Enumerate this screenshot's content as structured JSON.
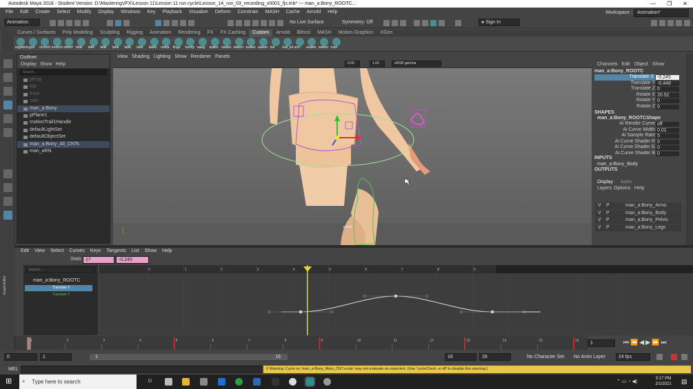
{
  "title": "Autodesk Maya 2018 - Student Version: D:\\MasteringVFX\\Lesson 11\\Lesson 11 run cycle\\Lesson_14_run_03_recording_v0001_fjs.mb* --- man_a:Bony_ROOTC...",
  "menubar": [
    "File",
    "Edit",
    "Create",
    "Select",
    "Modify",
    "Display",
    "Windows",
    "Key",
    "Playback",
    "Visualize",
    "Deform",
    "Constrain",
    "MASH",
    "Cache",
    "Arnold",
    "Help"
  ],
  "workspace": {
    "label": "Workspace :",
    "value": "Animation*"
  },
  "statusline": {
    "mode": "Animation",
    "live_surface": "No Live Surface",
    "symmetry": "Symmetry: Off",
    "signin": "Sign In"
  },
  "shelf_tabs": [
    "Curves / Surfaces",
    "Poly Modeling",
    "Sculpting",
    "Rigging",
    "Animation",
    "Rendering",
    "FX",
    "FX Caching",
    "Custom",
    "Arnold",
    "Bifrost",
    "MASH",
    "Motion Graphics",
    "XGen"
  ],
  "shelf_active": "Custom",
  "shelf_buttons": [
    "mgskint",
    "cgull",
    "mcbich",
    "mcbich",
    "mbitcf",
    "tattk",
    "tattk",
    "tattk",
    "tattk",
    "tattk",
    "tattk",
    "tatAll",
    "mafia",
    "fings",
    "handy",
    "aaog",
    "walke",
    "walker",
    "walker",
    "walker",
    "walker",
    "tail",
    "ball_tal",
    "arm",
    "walker",
    "walker",
    "man"
  ],
  "outliner": {
    "title": "Outliner",
    "menu": [
      "Display",
      "Show",
      "Help"
    ],
    "search": "Search...",
    "items": [
      {
        "label": "persp",
        "dim": true
      },
      {
        "label": "top",
        "dim": true
      },
      {
        "label": "front",
        "dim": true
      },
      {
        "label": "side",
        "dim": true
      },
      {
        "label": "man_a:Bony",
        "sel": true
      },
      {
        "label": "pPlane1"
      },
      {
        "label": "motionTrail1Handle"
      },
      {
        "label": "defaultLightSet"
      },
      {
        "label": "defaultObjectSet"
      },
      {
        "label": "man_a:Bony_All_CNTs",
        "sel": true
      },
      {
        "label": "man_aRN"
      }
    ]
  },
  "viewport": {
    "menu": [
      "View",
      "Shading",
      "Lighting",
      "Show",
      "Renderer",
      "Panels"
    ],
    "val1": "0.00",
    "val2": "1.00",
    "colorspace": "sRGB gamma",
    "camera": "persp"
  },
  "channelbox": {
    "menu": [
      "Channels",
      "Edit",
      "Object",
      "Show"
    ],
    "node": "man_a:Bony_ROOTC",
    "channels": [
      {
        "name": "Translate X",
        "value": "-0.245",
        "hi": true
      },
      {
        "name": "Translate Y",
        "value": "-0.448"
      },
      {
        "name": "Translate Z",
        "value": "0"
      },
      {
        "name": "Rotate X",
        "value": "20.52"
      },
      {
        "name": "Rotate Y",
        "value": "0"
      },
      {
        "name": "Rotate Z",
        "value": "0"
      }
    ],
    "shapes_label": "SHAPES",
    "shape_node": "man_a:Bony_ROOTCShape",
    "shape_attrs": [
      {
        "name": "Ai Render Curve",
        "value": "off"
      },
      {
        "name": "Ai Curve Width",
        "value": "0.01"
      },
      {
        "name": "Ai Sample Rate",
        "value": "5"
      },
      {
        "name": "Ai Curve Shader R",
        "value": "0"
      },
      {
        "name": "Ai Curve Shader G",
        "value": "0"
      },
      {
        "name": "Ai Curve Shader B",
        "value": "0"
      }
    ],
    "inputs_label": "INPUTS",
    "input_node": "man_a:Bony_Body",
    "outputs_label": "OUTPUTS"
  },
  "layers": {
    "tabs": [
      "Display",
      "Anim"
    ],
    "menu": [
      "Layers",
      "Options",
      "Help"
    ],
    "rows": [
      "man_a:Bony_Arms",
      "man_a:Bony_Body",
      "man_a:Bony_Pelvis",
      "man_a:Bony_Legs"
    ]
  },
  "graph_editor": {
    "side_label": "Graph Editor",
    "menu": [
      "Edit",
      "View",
      "Select",
      "Curves",
      "Keys",
      "Tangents",
      "List",
      "Show",
      "Help"
    ],
    "stats_label": "Stats",
    "stat1": "17",
    "stat2": "-0.245",
    "search": "Search...",
    "node": "man_a:Bony_ROOTC",
    "curves": [
      "Translate X",
      "Translate Y"
    ],
    "ruler": [
      "0",
      "1",
      "2",
      "3",
      "4",
      "5",
      "6",
      "7",
      "8",
      "9",
      "10",
      "11",
      "12",
      "13",
      "14"
    ],
    "current_frame": "17"
  },
  "timeslider": {
    "ticks": [
      "1",
      "2",
      "3",
      "4",
      "5",
      "6",
      "7",
      "8",
      "9",
      "10",
      "11",
      "12",
      "13",
      "14",
      "15",
      "16"
    ],
    "current": "1"
  },
  "range": {
    "start": "0",
    "inner_start": "1",
    "range_start": "1",
    "range_end": "16",
    "end_inner": "16",
    "end": "28",
    "character_set": "No Character Set",
    "anim_layer": "No Anim Layer",
    "fps": "24 fps"
  },
  "cmdline": {
    "label": "MEL",
    "warning": "// Warning: Cycle on 'man_a:Bony_Main_CNT.scale' may not evaluate as expected. (Use 'cycleCheck -e off' to disable this warning.)"
  },
  "taskbar": {
    "search": "Type here to search",
    "time": "5:17 PM",
    "date": "2/1/2021"
  }
}
